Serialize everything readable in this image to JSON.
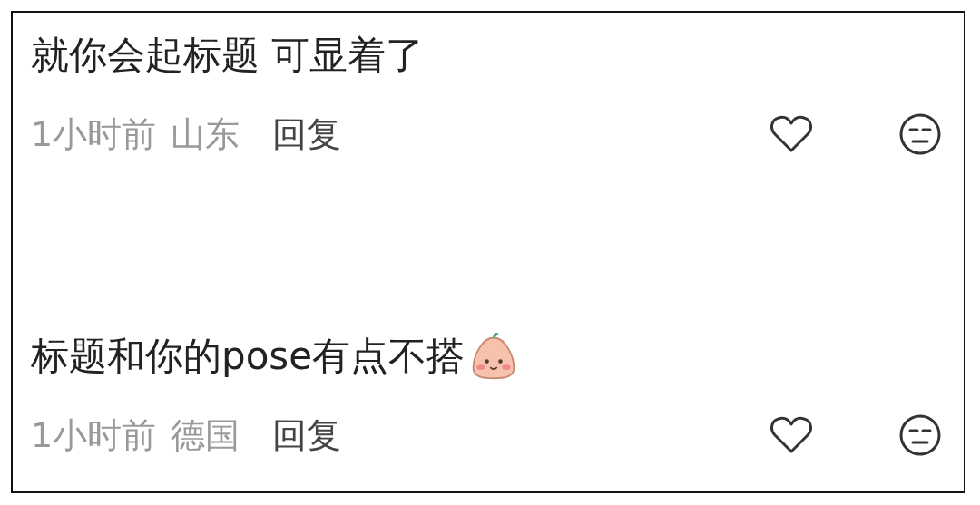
{
  "comments": [
    {
      "text": "就你会起标题 可显着了",
      "has_emoji": false,
      "time": "1小时前",
      "location": "山东",
      "reply": "回复"
    },
    {
      "text": "标题和你的pose有点不搭",
      "has_emoji": true,
      "time": "1小时前",
      "location": "德国",
      "reply": "回复"
    }
  ]
}
